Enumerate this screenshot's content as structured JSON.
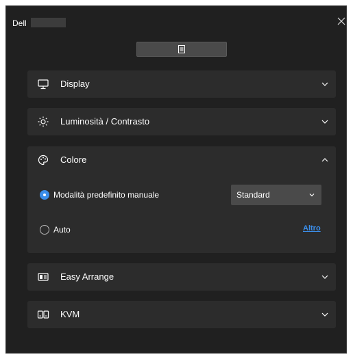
{
  "window": {
    "brand": "Dell",
    "close_icon": "close-icon",
    "menu_icon": "document-list-icon"
  },
  "sections": {
    "display": {
      "label": "Display",
      "icon": "monitor-icon",
      "expanded": false
    },
    "brightness": {
      "label": "Luminosità / Contrasto",
      "icon": "brightness-icon",
      "expanded": false
    },
    "color": {
      "label": "Colore",
      "icon": "palette-icon",
      "expanded": true,
      "manual_preset_label": "Modalità predefinito manuale",
      "manual_preset_selected": true,
      "preset_value": "Standard",
      "auto_label": "Auto",
      "auto_selected": false,
      "more_link": "Altro"
    },
    "easy_arrange": {
      "label": "Easy Arrange",
      "icon": "layout-icon",
      "expanded": false
    },
    "kvm": {
      "label": "KVM",
      "icon": "kvm-icon",
      "expanded": false
    }
  },
  "colors": {
    "background": "#202020",
    "panel": "#2c2c2c",
    "control": "#4a4a4a",
    "accent": "#3b8eea",
    "text": "#ffffff"
  }
}
